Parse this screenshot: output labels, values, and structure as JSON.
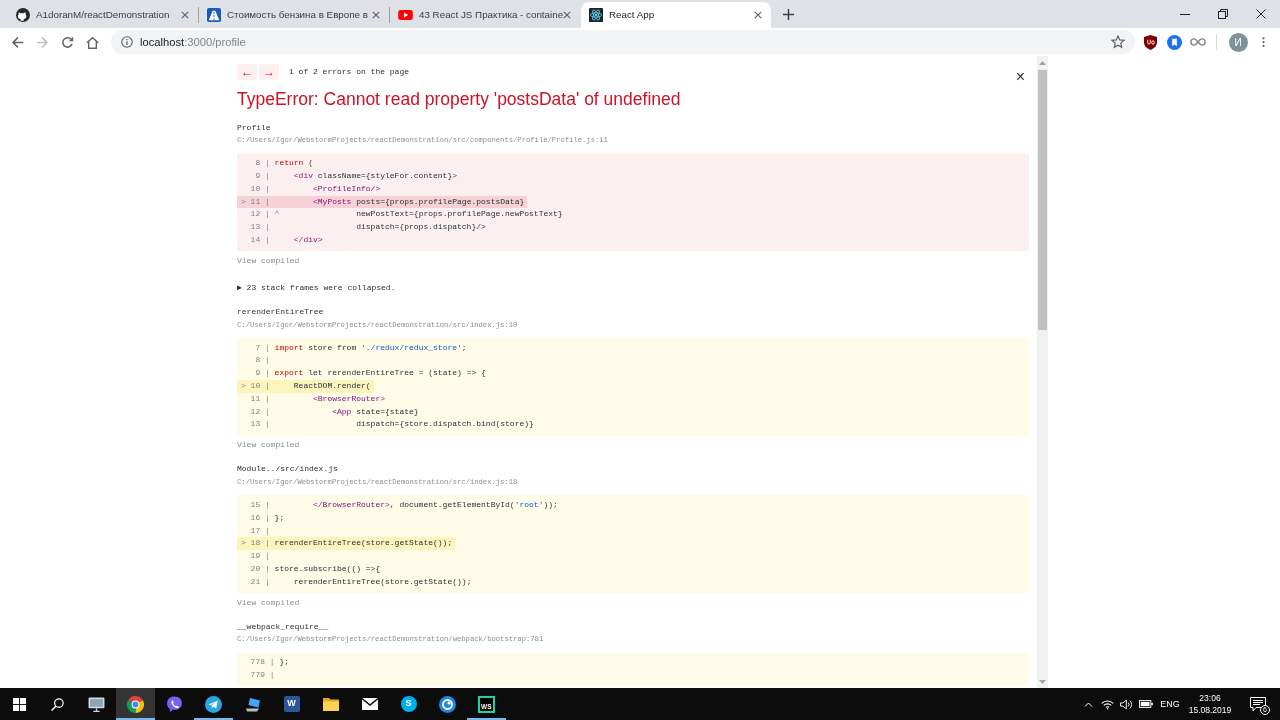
{
  "browser": {
    "tabs": [
      {
        "title": "A1doranM/reactDemonstration",
        "selected": false
      },
      {
        "title": "Стоимость бензина в Европе в",
        "selected": false
      },
      {
        "title": "43 React JS Практика - containe",
        "selected": false
      },
      {
        "title": "React App",
        "selected": true
      }
    ],
    "toolbar": {
      "back_disabled": false,
      "forward_disabled": true
    },
    "url": {
      "host": "localhost",
      "rest": ":3000/profile"
    },
    "avatar": "И"
  },
  "error_overlay": {
    "nav": [
      {
        "label": "←"
      },
      {
        "label": "→"
      }
    ],
    "counter": "1 of 2 errors on the page",
    "close": "×",
    "title": "TypeError: Cannot read property 'postsData' of undefined",
    "stack": [
      {
        "kind": "frame",
        "function": "Profile",
        "path": "C:/Users/Igor/WebstormProjects/reactDemonstration/src/components/Profile/Profile.js:11",
        "primary": true,
        "lines": [
          {
            "gutter": "8 |",
            "highlighted": false,
            "tokens": [
              {
                "kind": "keyword",
                "text": "return"
              },
              {
                "kind": "plain",
                "text": " ("
              }
            ]
          },
          {
            "gutter": "9 |",
            "highlighted": false,
            "tokens": [
              {
                "kind": "tag",
                "text": "    <div"
              },
              {
                "kind": "plain",
                "text": " className={styleFor.content}"
              },
              {
                "kind": "tag",
                "text": ">"
              }
            ]
          },
          {
            "gutter": "10 |",
            "highlighted": false,
            "tokens": [
              {
                "kind": "tag",
                "text": "        <ProfileInfo/>"
              }
            ]
          },
          {
            "gutter": "> 11 |",
            "highlighted": true,
            "tokens": [
              {
                "kind": "tag",
                "text": "        <MyPosts"
              },
              {
                "kind": "plain",
                "text": " posts={props.profilePage.postsData}"
              }
            ]
          },
          {
            "gutter": "12 |",
            "highlighted": false,
            "tokens": [
              {
                "kind": "caret",
                "text": "^"
              },
              {
                "kind": "plain",
                "text": "                newPostText={props.profilePage.newPostText}"
              }
            ]
          },
          {
            "gutter": "13 |",
            "highlighted": false,
            "tokens": [
              {
                "kind": "plain",
                "text": "                 dispatch={props.dispatch}/>"
              }
            ]
          },
          {
            "gutter": "14 |",
            "highlighted": false,
            "tokens": [
              {
                "kind": "tag",
                "text": "    </div>"
              }
            ]
          }
        ],
        "view_compiled": "View compiled"
      },
      {
        "kind": "collapsed",
        "text": "▶ 23 stack frames were collapsed."
      },
      {
        "kind": "frame",
        "function": "rerenderEntireTree",
        "path": "C:/Users/Igor/WebstormProjects/reactDemonstration/src/index.js:10",
        "primary": false,
        "lines": [
          {
            "gutter": "7 |",
            "highlighted": false,
            "tokens": [
              {
                "kind": "keyword",
                "text": "import"
              },
              {
                "kind": "plain",
                "text": " store from "
              },
              {
                "kind": "string",
                "text": "'./redux/redux_store'"
              },
              {
                "kind": "plain",
                "text": ";"
              }
            ]
          },
          {
            "gutter": "8 |",
            "highlighted": false
          },
          {
            "gutter": "9 |",
            "highlighted": false,
            "tokens": [
              {
                "kind": "keyword",
                "text": "export"
              },
              {
                "kind": "plain",
                "text": " let rerenderEntireTree = (state) => {"
              }
            ]
          },
          {
            "gutter": "> 10 |",
            "highlighted": true,
            "tokens": [
              {
                "kind": "plain",
                "text": "    ReactDOM.render("
              }
            ]
          },
          {
            "gutter": "11 |",
            "highlighted": false,
            "tokens": [
              {
                "kind": "tag",
                "text": "        <BrowserRouter>"
              }
            ]
          },
          {
            "gutter": "12 |",
            "highlighted": false,
            "tokens": [
              {
                "kind": "tag",
                "text": "            <App"
              },
              {
                "kind": "plain",
                "text": " state={state}"
              }
            ]
          },
          {
            "gutter": "13 |",
            "highlighted": false,
            "tokens": [
              {
                "kind": "plain",
                "text": "                 dispatch={store.dispatch.bind(store)}"
              }
            ]
          }
        ],
        "view_compiled": "View compiled"
      },
      {
        "kind": "frame",
        "function": "Module../src/index.js",
        "path": "C:/Users/Igor/WebstormProjects/reactDemonstration/src/index.js:18",
        "primary": false,
        "lines": [
          {
            "gutter": "15 |",
            "highlighted": false,
            "tokens": [
              {
                "kind": "tag",
                "text": "        </BrowserRouter>"
              },
              {
                "kind": "plain",
                "text": ", document.getElementById("
              },
              {
                "kind": "string",
                "text": "'root'"
              },
              {
                "kind": "plain",
                "text": "));"
              }
            ]
          },
          {
            "gutter": "16 |",
            "highlighted": false,
            "tokens": [
              {
                "kind": "plain",
                "text": "};"
              }
            ]
          },
          {
            "gutter": "17 |",
            "highlighted": false
          },
          {
            "gutter": "> 18 |",
            "highlighted": true,
            "tokens": [
              {
                "kind": "plain",
                "text": "rerenderEntireTree(store.getState());"
              }
            ]
          },
          {
            "gutter": "19 |",
            "highlighted": false
          },
          {
            "gutter": "20 |",
            "highlighted": false,
            "tokens": [
              {
                "kind": "plain",
                "text": "store.subscribe(() =>{"
              }
            ]
          },
          {
            "gutter": "21 |",
            "highlighted": false,
            "tokens": [
              {
                "kind": "plain",
                "text": "    rerenderEntireTree(store.getState());"
              }
            ]
          }
        ],
        "view_compiled": "View compiled"
      },
      {
        "kind": "frame",
        "function": "__webpack_require__",
        "path": "C:/Users/Igor/WebstormProjects/reactDemonstration/webpack/bootstrap:781",
        "primary": false,
        "lines": [
          {
            "gutter": "778 |",
            "highlighted": false,
            "tokens": [
              {
                "kind": "plain",
                "text": "};"
              }
            ]
          },
          {
            "gutter": "779 |",
            "highlighted": false
          }
        ]
      }
    ]
  },
  "taskbar": {
    "apps": [
      {
        "kind": "icon",
        "selected": false,
        "running": false
      },
      {
        "kind": "icon",
        "selected": true,
        "running": true
      },
      {
        "kind": "icon",
        "selected": false,
        "running": false
      },
      {
        "kind": "icon",
        "selected": false,
        "running": true
      },
      {
        "kind": "icon",
        "selected": false,
        "running": false
      },
      {
        "kind": "letter",
        "label": "W",
        "selected": false,
        "running": false
      },
      {
        "kind": "icon",
        "selected": false,
        "running": false
      },
      {
        "kind": "icon",
        "selected": false,
        "running": false
      },
      {
        "kind": "letter",
        "label": "S",
        "selected": false,
        "running": false
      },
      {
        "kind": "icon",
        "selected": false,
        "running": false
      },
      {
        "kind": "letter",
        "label": "WS",
        "selected": false,
        "running": true
      }
    ],
    "tray": {
      "language": "ENG",
      "time": "23:06",
      "date": "15.08.2019",
      "notifications": "6"
    }
  }
}
